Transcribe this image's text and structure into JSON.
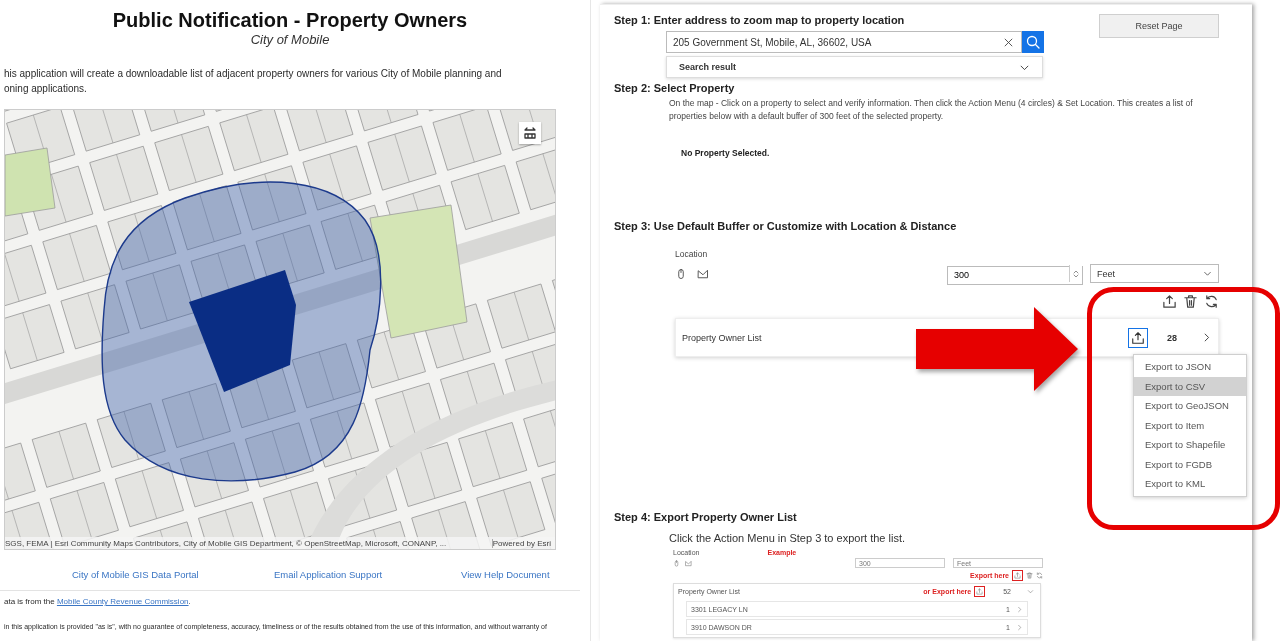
{
  "header": {
    "title": "Public Notification - Property Owners",
    "subtitle": "City of Mobile"
  },
  "intro": [
    "his application will create a downloadable list of adjacent property owners for various City of Mobile planning and",
    "oning applications."
  ],
  "map": {
    "attribution": "SGS, FEMA | Esri Community Maps Contributors, City of Mobile GIS Department, © OpenStreetMap, Microsoft, CONANP, ...",
    "powered_by": "Powered by Esri"
  },
  "links": [
    "City of Mobile GIS Data Portal",
    "Email Application Support",
    "View Help Document"
  ],
  "data_source": {
    "before": "ata is from the ",
    "link": "Mobile County Revenue Commission",
    "after": "."
  },
  "disclaimer": "in this application is provided \"as is\", with no guarantee of completeness, accuracy, timeliness or of the results obtained from the use of this information, and without warranty of",
  "reset_button": "Reset Page",
  "step1": {
    "heading": "Step 1: Enter address to zoom map to property location",
    "search": {
      "value": "205 Government St, Mobile, AL, 36602, USA"
    },
    "result_label": "Search result"
  },
  "step2": {
    "heading": "Step 2: Select Property",
    "description": "On the map - Click on a property to select and verify information. Then click the Action Menu (4 circles) & Set Location. This creates a list of properties below with a default buffer of 300 feet of the selected property.",
    "status": "No Property Selected."
  },
  "step3": {
    "heading": "Step 3: Use Default Buffer or Customize with Location & Distance",
    "location_label": "Location",
    "distance": {
      "value": "300"
    },
    "unit": "Feet",
    "list": {
      "title": "Property Owner List",
      "count": "28"
    },
    "export_menu": [
      {
        "label": "Export to JSON",
        "selected": false
      },
      {
        "label": "Export to CSV",
        "selected": true
      },
      {
        "label": "Export to GeoJSON",
        "selected": false
      },
      {
        "label": "Export to Item",
        "selected": false
      },
      {
        "label": "Export to Shapefile",
        "selected": false
      },
      {
        "label": "Export to FGDB",
        "selected": false
      },
      {
        "label": "Export to KML",
        "selected": false
      }
    ]
  },
  "step4": {
    "heading": "Step 4: Export Property Owner List",
    "instruction": "Click the Action Menu in Step 3 to export the list.",
    "example": {
      "location_label": "Location",
      "caption": "Example",
      "distance": "300",
      "unit": "Feet",
      "export_hint": "Export here",
      "list_title": "Property Owner List",
      "list_hint": "or Export here",
      "count": "52",
      "rows": [
        {
          "address": "3301 LEGACY LN",
          "count": "1"
        },
        {
          "address": "3910 DAWSON DR",
          "count": "1"
        }
      ]
    }
  }
}
